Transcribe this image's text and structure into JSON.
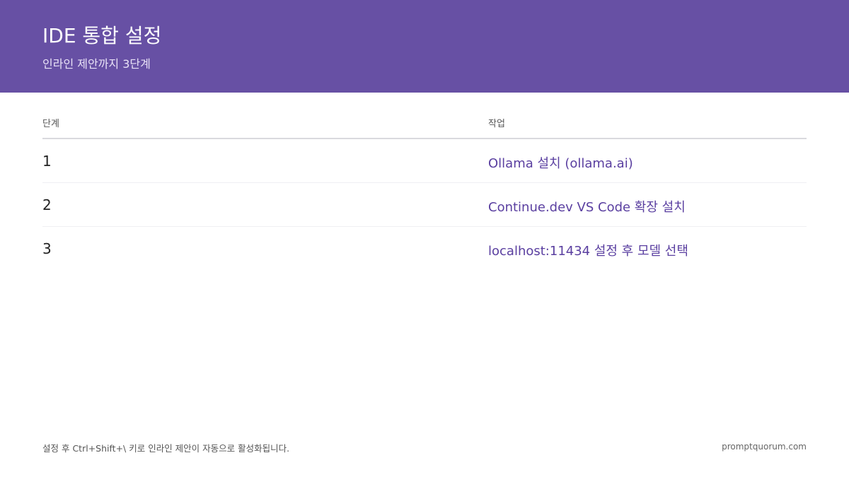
{
  "header": {
    "title": "IDE 통합 설정",
    "subtitle": "인라인 제안까지 3단계"
  },
  "table": {
    "columns": [
      "단계",
      "작업"
    ],
    "rows": [
      {
        "step": "1",
        "task": "Ollama 설치 (ollama.ai)"
      },
      {
        "step": "2",
        "task": "Continue.dev VS Code 확장 설치"
      },
      {
        "step": "3",
        "task": "localhost:11434 설정 후 모델 선택"
      }
    ]
  },
  "footer": {
    "note": "설정 후 Ctrl+Shift+\\ 키로 인라인 제안이 자동으로 활성화됩니다.",
    "brand": "promptquorum.com"
  },
  "colors": {
    "header_bg": "#6750a4",
    "accent_text": "#5a3fa0"
  }
}
